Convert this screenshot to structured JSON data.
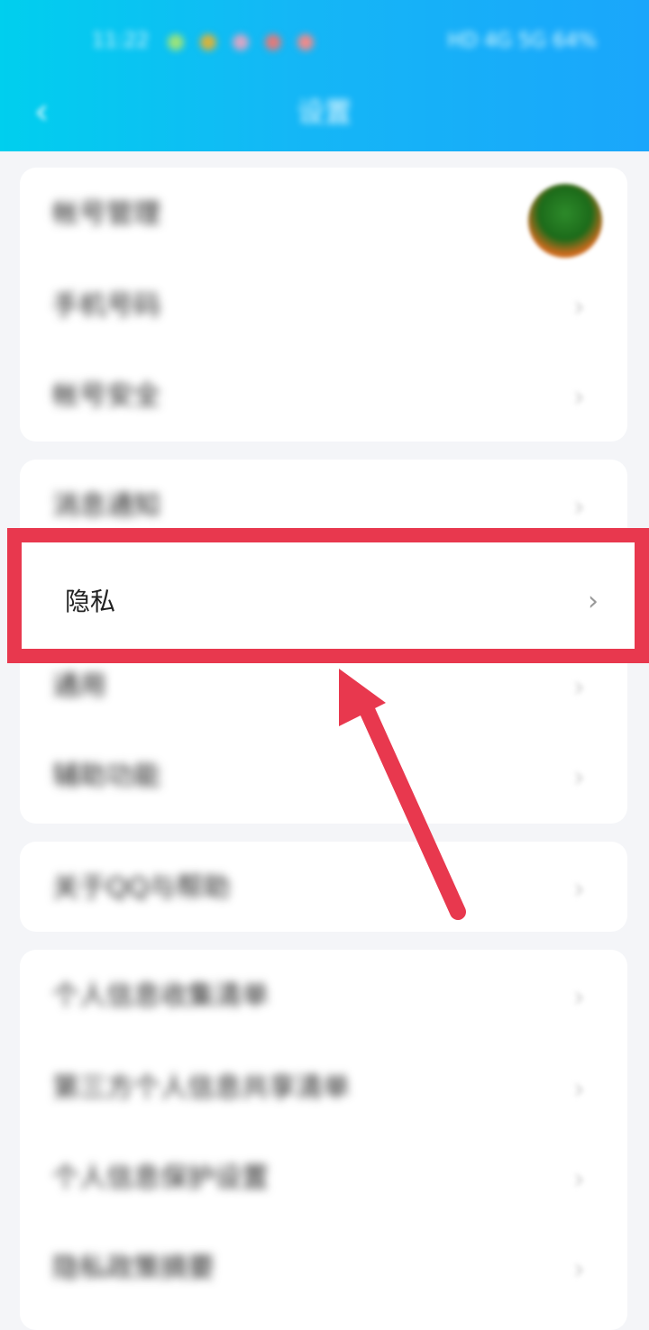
{
  "status_bar": {
    "time": "11:22",
    "right_text": "HD 4G 5G 64%"
  },
  "header": {
    "title": "设置",
    "back_icon": "chevron-left-icon"
  },
  "groups": [
    {
      "items": [
        {
          "label": "帐号管理",
          "trailing": "avatar"
        },
        {
          "label": "手机号码",
          "trailing": "chevron-right-icon"
        },
        {
          "label": "帐号安全",
          "trailing": "chevron-right-icon"
        }
      ]
    },
    {
      "items": [
        {
          "label": "消息通知",
          "trailing": "chevron-right-icon"
        },
        {
          "label": "隐私",
          "trailing": "chevron-right-icon"
        },
        {
          "label": "通用",
          "trailing": "chevron-right-icon"
        },
        {
          "label": "辅助功能",
          "trailing": "chevron-right-icon"
        }
      ]
    },
    {
      "items": [
        {
          "label": "关于QQ与帮助",
          "trailing": "chevron-right-icon"
        }
      ]
    },
    {
      "items": [
        {
          "label": "个人信息收集清单",
          "trailing": "chevron-right-icon"
        },
        {
          "label": "第三方个人信息共享清单",
          "trailing": "chevron-right-icon"
        },
        {
          "label": "个人信息保护设置",
          "trailing": "chevron-right-icon"
        },
        {
          "label": "隐私政策摘要",
          "trailing": "chevron-right-icon"
        }
      ]
    }
  ],
  "highlight": {
    "label": "隐私",
    "color": "#e8384e"
  },
  "colors": {
    "header_start": "#00cfee",
    "header_end": "#1aa6fb",
    "background": "#f4f5f8",
    "annotation": "#e8384e"
  }
}
